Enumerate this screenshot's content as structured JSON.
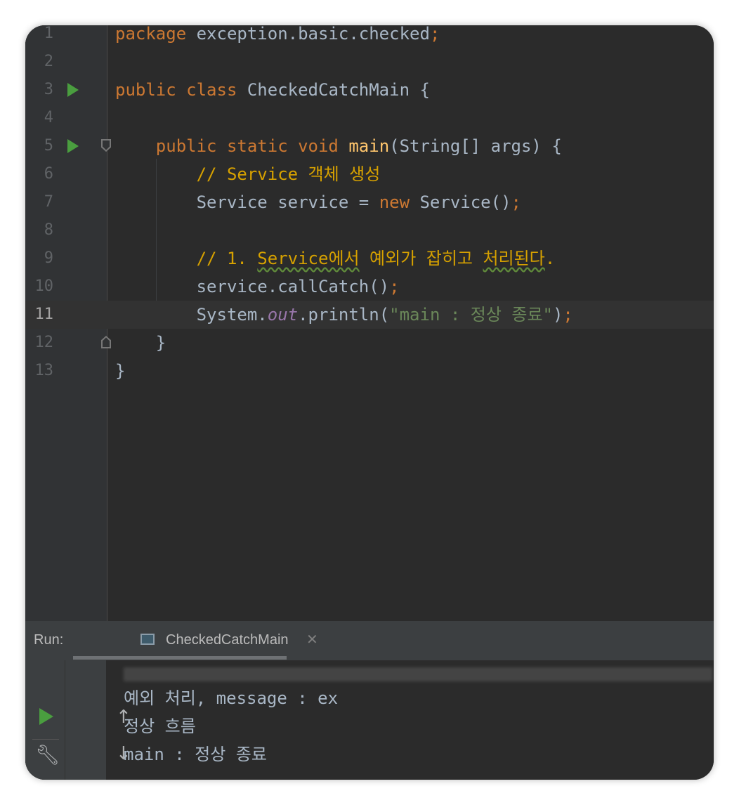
{
  "editor": {
    "lines": [
      {
        "num": "1",
        "parts": [
          [
            "kw",
            "package "
          ],
          [
            "pl",
            "exception.basic.checked"
          ],
          [
            "kw",
            ";"
          ]
        ]
      },
      {
        "num": "2",
        "parts": []
      },
      {
        "num": "3",
        "run": true,
        "parts": [
          [
            "kw",
            "public class "
          ],
          [
            "pl",
            "CheckedCatchMain {"
          ]
        ]
      },
      {
        "num": "4",
        "parts": []
      },
      {
        "num": "5",
        "run": true,
        "fold": "down",
        "parts": [
          [
            "pl",
            "    "
          ],
          [
            "kw",
            "public static void "
          ],
          [
            "fn",
            "main"
          ],
          [
            "pl",
            "(String[] args) {"
          ]
        ]
      },
      {
        "num": "6",
        "parts": [
          [
            "pl",
            "        "
          ],
          [
            "cm",
            "// Service 객체 생성"
          ]
        ]
      },
      {
        "num": "7",
        "parts": [
          [
            "pl",
            "        Service service = "
          ],
          [
            "kw",
            "new "
          ],
          [
            "pl",
            "Service()"
          ],
          [
            "kw",
            ";"
          ]
        ]
      },
      {
        "num": "8",
        "parts": []
      },
      {
        "num": "9",
        "parts": [
          [
            "pl",
            "        "
          ],
          [
            "cm",
            "// 1. "
          ],
          [
            "cmsq",
            "Service에서"
          ],
          [
            "cm",
            " 예외가 잡히고 "
          ],
          [
            "cmsq",
            "처리된다"
          ],
          [
            "cm",
            "."
          ]
        ]
      },
      {
        "num": "10",
        "parts": [
          [
            "pl",
            "        service.callCatch()"
          ],
          [
            "kw",
            ";"
          ]
        ]
      },
      {
        "num": "11",
        "current": true,
        "parts": [
          [
            "pl",
            "        System."
          ],
          [
            "field",
            "out"
          ],
          [
            "pl",
            ".println("
          ],
          [
            "str",
            "\"main : 정상 종료\""
          ],
          [
            "pl",
            ")"
          ],
          [
            "kw",
            ";"
          ]
        ]
      },
      {
        "num": "12",
        "fold": "up",
        "parts": [
          [
            "pl",
            "    }"
          ]
        ]
      },
      {
        "num": "13",
        "parts": [
          [
            "pl",
            "}"
          ]
        ]
      }
    ]
  },
  "run_panel": {
    "label": "Run:",
    "tab_label": "CheckedCatchMain",
    "tab_close": "✕",
    "console_lines": [
      "예외 처리, message : ex",
      "정상 흐름",
      "main : 정상 종료"
    ]
  },
  "icons": {
    "rerun": "play-icon",
    "settings": "wrench-icon",
    "stop": "stop-icon",
    "scroll_up": "arrow-up-icon",
    "scroll_down": "arrow-down-icon",
    "soft_wrap": "soft-wrap-icon"
  },
  "colors": {
    "keyword": "#cc7832",
    "function": "#ffc66d",
    "comment": "#d6a100",
    "string": "#6a8759",
    "field": "#9876aa",
    "plain": "#a9b7c6",
    "run_green": "#4a9e3f"
  }
}
